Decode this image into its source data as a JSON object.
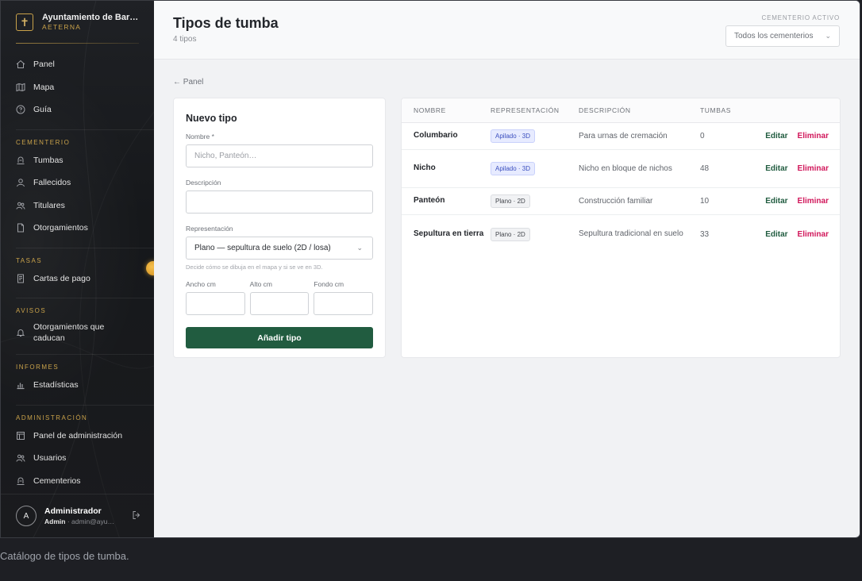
{
  "brand": {
    "title": "Ayuntamiento de Barba…",
    "subtitle": "AETERNA"
  },
  "nav": {
    "panel": "Panel",
    "map": "Mapa",
    "guide": "Guía",
    "section_cemetery": "CEMENTERIO",
    "tombs": "Tumbas",
    "deceased": "Fallecidos",
    "holders": "Titulares",
    "grants": "Otorgamientos",
    "section_fees": "TASAS",
    "payment_letters": "Cartas de pago",
    "section_notices": "AVISOS",
    "expiring_grants_line1": "Otorgamientos que",
    "expiring_grants_line2": "caducan",
    "section_reports": "INFORMES",
    "statistics": "Estadísticas",
    "section_admin": "ADMINISTRACIÓN",
    "admin_panel": "Panel de administración",
    "users": "Usuarios",
    "cemeteries": "Cementerios"
  },
  "user": {
    "initial": "A",
    "name": "Administrador",
    "role": "Admin",
    "email": "· admin@ayu…"
  },
  "header": {
    "title": "Tipos de tumba",
    "subtitle": "4 tipos",
    "cemetery_label": "CEMENTERIO ACTIVO",
    "cemetery_value": "Todos los cementerios"
  },
  "back_link": "← Panel",
  "form": {
    "title": "Nuevo tipo",
    "name_label": "Nombre *",
    "name_placeholder": "Nicho, Panteón…",
    "description_label": "Descripción",
    "description_value": "",
    "representation_label": "Representación",
    "representation_value": "Plano — sepultura de suelo (2D / losa)",
    "representation_hint": "Decide cómo se dibuja en el mapa y si se ve en 3D.",
    "width_label": "Ancho cm",
    "height_label": "Alto cm",
    "depth_label": "Fondo cm",
    "submit_label": "Añadir tipo"
  },
  "table": {
    "headers": [
      "NOMBRE",
      "REPRESENTACIÓN",
      "DESCRIPCIÓN",
      "TUMBAS"
    ],
    "edit_label": "Editar",
    "delete_label": "Eliminar",
    "rows": [
      {
        "name": "Columbario",
        "representation": "Apilado · 3D",
        "kind": "3d",
        "description": "Para urnas de cremación",
        "count": "0"
      },
      {
        "name": "Nicho",
        "representation": "Apilado · 3D",
        "kind": "3d",
        "description": "Nicho en bloque de nichos",
        "count": "48"
      },
      {
        "name": "Panteón",
        "representation": "Plano · 2D",
        "kind": "2d",
        "description": "Construcción familiar",
        "count": "10"
      },
      {
        "name": "Sepultura en tierra",
        "representation": "Plano · 2D",
        "kind": "2d",
        "description": "Sepultura tradicional en suelo",
        "count": "33"
      }
    ]
  },
  "caption": "Catálogo de tipos de tumba.",
  "colors": {
    "accent_green": "#215c40",
    "danger": "#d1165a",
    "gold": "#c9a24a"
  }
}
